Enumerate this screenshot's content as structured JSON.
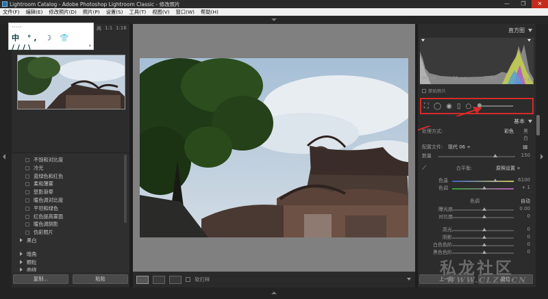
{
  "window": {
    "title": "Lightroom Catalog - Adobe Photoshop Lightroom Classic - 修改照片",
    "controls": [
      "—",
      "❐",
      "✕"
    ]
  },
  "menubar": [
    "文件(F)",
    "编辑(E)",
    "修改照片(D)",
    "照片(P)",
    "设置(S)",
    "工具(T)",
    "视图(V)",
    "窗口(W)",
    "帮助(H)"
  ],
  "navigator": {
    "zoom_options": [
      "1:1",
      "1:16"
    ],
    "label_partial": "两"
  },
  "sticker": {
    "glyphs": "中 °, ☽ 👕 ///\\"
  },
  "presets": [
    "不饱和对比度",
    "冷光",
    "蓝绿色和红色",
    "柔和薄雾",
    "怒影渐晕",
    "暖色调对比度",
    "平坦和绿色",
    "红色提高雾面",
    "暖色调阴影",
    "伪彩照片"
  ],
  "preset_groups": [
    "黑白",
    "暗角",
    "颗粒",
    "曲线"
  ],
  "left_buttons": {
    "copy": "复制...",
    "paste": "粘贴"
  },
  "toolbar": {
    "soft_proof": "软打样"
  },
  "histogram": {
    "title": "直方图",
    "iso": "ISO 64",
    "focal": "50 mm",
    "aperture": "f / 8.0",
    "shutter": "1/125 秒",
    "original_photo": "原始照片"
  },
  "basic": {
    "title": "基本",
    "treatment_label": "处理方式:",
    "treatment_color": "彩色",
    "treatment_bw": "黑白",
    "profile_label": "配置文件:",
    "profile_value": "现代 06 ÷",
    "amount_label": "数量",
    "amount_value": "150",
    "wb_label": "白平衡:",
    "wb_value": "原照设置 ÷",
    "temp_label": "色温",
    "temp_value": "6100",
    "tint_label": "色调",
    "tint_value": "+ 1",
    "tone_label": "色调",
    "tone_auto": "自动",
    "exposure_label": "曝光度",
    "exposure_value": "0.00",
    "contrast_label": "对比度",
    "contrast_value": "0",
    "highlights_label": "高光",
    "highlights_value": "0",
    "shadows_label": "阴影",
    "shadows_value": "0",
    "whites_label": "白色色阶",
    "whites_value": "0",
    "blacks_label": "黑色色阶",
    "blacks_value": "0"
  },
  "right_buttons": {
    "prev": "上一张",
    "reset": "复位"
  },
  "watermark": {
    "big": "私龙社区",
    "small": "WWW.CLZG.CN"
  },
  "colors": {
    "highlight_red": "#d52b2b",
    "panel": "#2c2c2c",
    "canvas": "#808080"
  }
}
